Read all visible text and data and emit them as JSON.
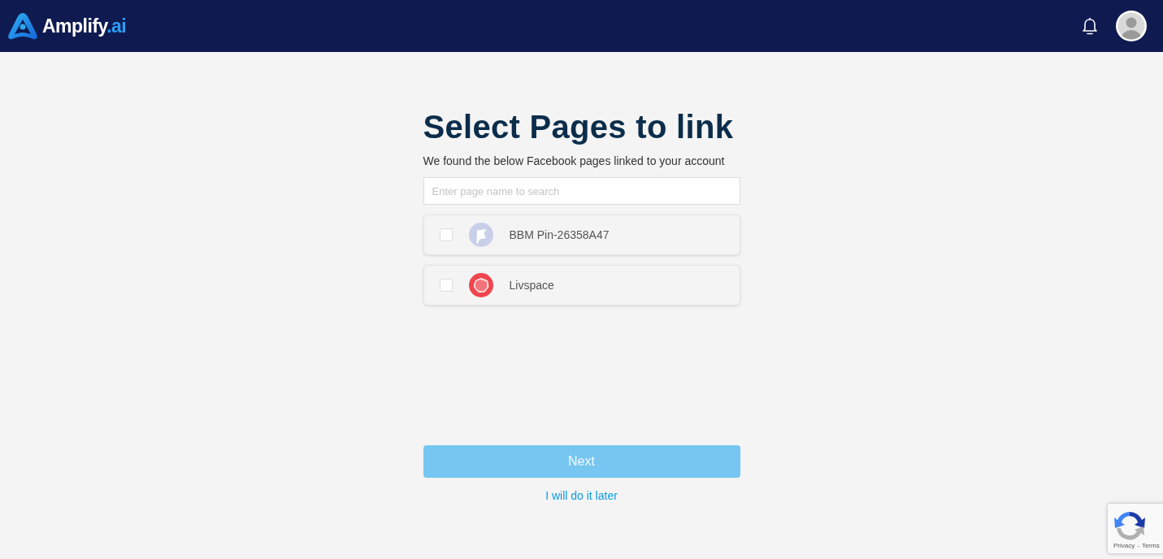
{
  "header": {
    "logo": {
      "name": "Amplify",
      "suffix": ".ai"
    }
  },
  "main": {
    "title": "Select Pages to link",
    "subtitle": "We found the below Facebook pages linked to your account",
    "search": {
      "placeholder": "Enter page name to search"
    },
    "pages": [
      {
        "name": "BBM Pin-26358A47",
        "checked": false,
        "color": "#c9cfe8"
      },
      {
        "name": "Livspace",
        "checked": false,
        "color": "#f0464f"
      }
    ],
    "next_button": {
      "label": "Next",
      "disabled": true
    },
    "later_link": "I will do it later"
  },
  "recaptcha": {
    "privacy": "Privacy",
    "separator": "-",
    "terms": "Terms"
  }
}
